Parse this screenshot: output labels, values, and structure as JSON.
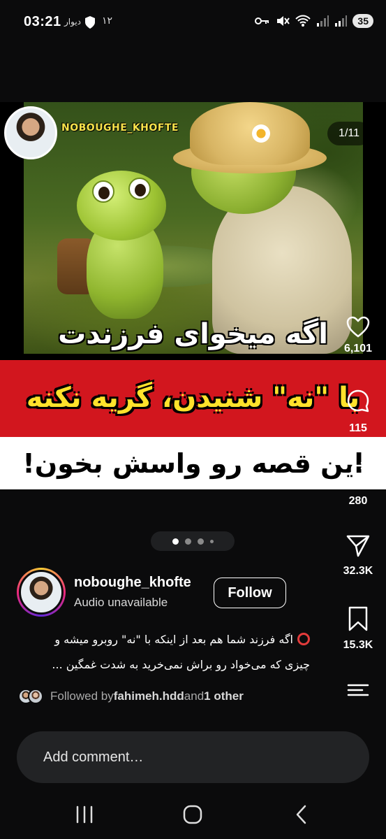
{
  "status_bar": {
    "time": "03:21",
    "app_label": "دیوار",
    "notif_count": "۱۲",
    "battery": "35"
  },
  "post": {
    "overlay_username": "NOBOUGHE_KHOFTE",
    "slide_counter": "1/11",
    "headline_line1": "اگه میخوای فرزندت",
    "headline_line2": "با \"نه\" شنیدن، گریه نکنه",
    "headline_line3": "این قصه رو واسش بخون!",
    "carousel_dots": 4,
    "active_dot": 0
  },
  "actions": {
    "likes": "6,101",
    "comments": "115",
    "reposts": "280",
    "shares": "32.3K",
    "saves": "15.3K"
  },
  "author": {
    "username": "noboughe_khofte",
    "audio": "Audio unavailable",
    "follow_label": "Follow"
  },
  "caption": {
    "line1": "اگه فرزند شما هم بعد از اینکه با \"نه\" روبرو میشه و",
    "line2": "چیزی که می‌خواد رو براش نمی‌خرید به شدت غمگین ..."
  },
  "followed_by": {
    "prefix": "Followed by ",
    "user": "fahimeh.hdd",
    "middle": " and ",
    "others": "1 other"
  },
  "comment": {
    "placeholder": "Add comment…"
  },
  "colors": {
    "background": "#0b0b0c",
    "red_band": "#d2161e",
    "headline_yellow": "#ffe22b",
    "username_yellow": "#f7e34a"
  }
}
